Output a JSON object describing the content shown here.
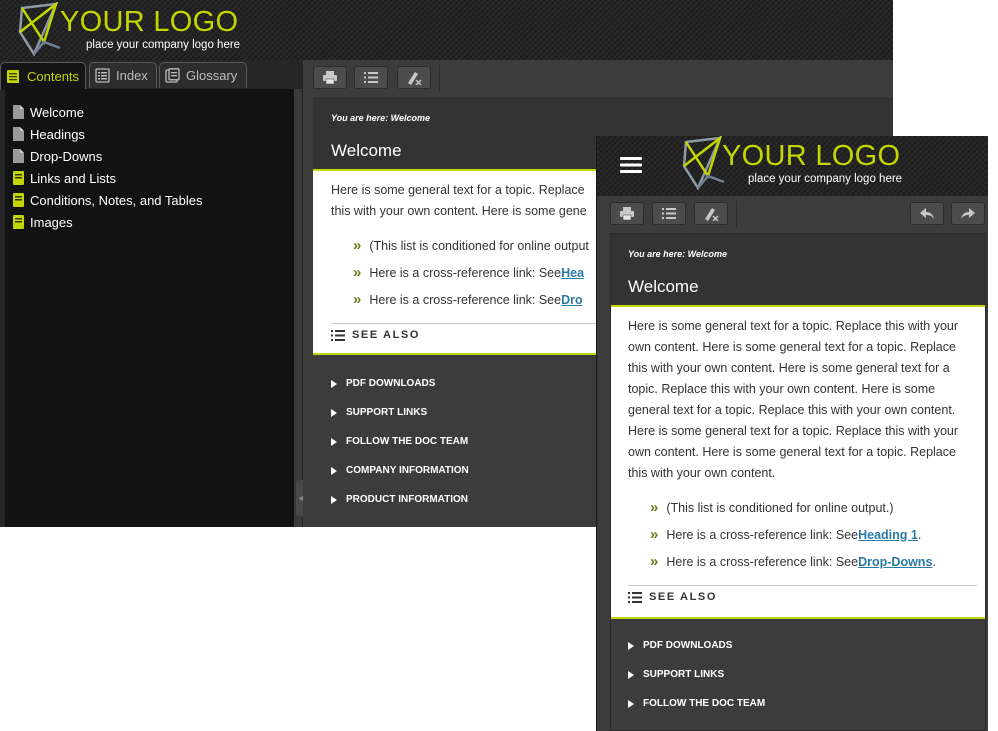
{
  "brand": {
    "logo_text": "YOUR LOGO",
    "tagline": "place your company logo here",
    "accent_color": "#c4d600",
    "link_color": "#2a7aa6"
  },
  "desktop": {
    "tabs": [
      {
        "label": "Contents",
        "icon": "book-icon",
        "active": true
      },
      {
        "label": "Index",
        "icon": "list-icon",
        "active": false
      },
      {
        "label": "Glossary",
        "icon": "glossary-icon",
        "active": false
      }
    ],
    "toc": [
      {
        "label": "Welcome",
        "icon": "page-icon"
      },
      {
        "label": "Headings",
        "icon": "page-icon"
      },
      {
        "label": "Drop-Downs",
        "icon": "page-icon"
      },
      {
        "label": "Links and Lists",
        "icon": "book-icon"
      },
      {
        "label": "Conditions, Notes, and Tables",
        "icon": "book-icon"
      },
      {
        "label": "Images",
        "icon": "book-icon"
      }
    ],
    "toolbar": [
      "print-icon",
      "list-icon",
      "highlight-remove-icon"
    ],
    "breadcrumb": "You are here: Welcome",
    "title": "Welcome",
    "body_lines": [
      "Here is some general text for a topic. Replace",
      "this with your own content. Here is some gene"
    ],
    "bullets": [
      {
        "text": "(This list is conditioned for online output",
        "link": ""
      },
      {
        "text": "Here is a cross-reference link: See ",
        "link": "Hea"
      },
      {
        "text": "Here is a cross-reference link: See ",
        "link": "Dro"
      }
    ],
    "see_also": "SEE ALSO",
    "footer_links": [
      "PDF DOWNLOADS",
      "SUPPORT LINKS",
      "FOLLOW THE DOC TEAM",
      "COMPANY INFORMATION",
      "PRODUCT INFORMATION"
    ]
  },
  "mobile": {
    "toolbar": [
      "print-icon",
      "list-icon",
      "highlight-remove-icon"
    ],
    "nav": [
      "back-arrow-icon",
      "forward-arrow-icon"
    ],
    "breadcrumb": "You are here: Welcome",
    "title": "Welcome",
    "body_lines": [
      "Here is some general text for a topic. Replace this with your",
      "own content. Here is some general text for a topic. Replace",
      "this with your own content. Here is some general text for a",
      "topic. Replace this with your own content. Here is some",
      "general text for a topic. Replace this with your own content.",
      "Here is some general text for a topic. Replace this with your",
      "own content. Here is some general text for a topic. Replace",
      "this with your own content."
    ],
    "bullets": [
      {
        "text": "(This list is conditioned for online output.)",
        "link": "",
        "after": ""
      },
      {
        "text": "Here is a cross-reference link: See ",
        "link": "Heading 1",
        "after": "."
      },
      {
        "text": "Here is a cross-reference link: See ",
        "link": "Drop-Downs",
        "after": "."
      }
    ],
    "see_also": "SEE ALSO",
    "footer_links": [
      "PDF DOWNLOADS",
      "SUPPORT LINKS",
      "FOLLOW THE DOC TEAM"
    ]
  }
}
